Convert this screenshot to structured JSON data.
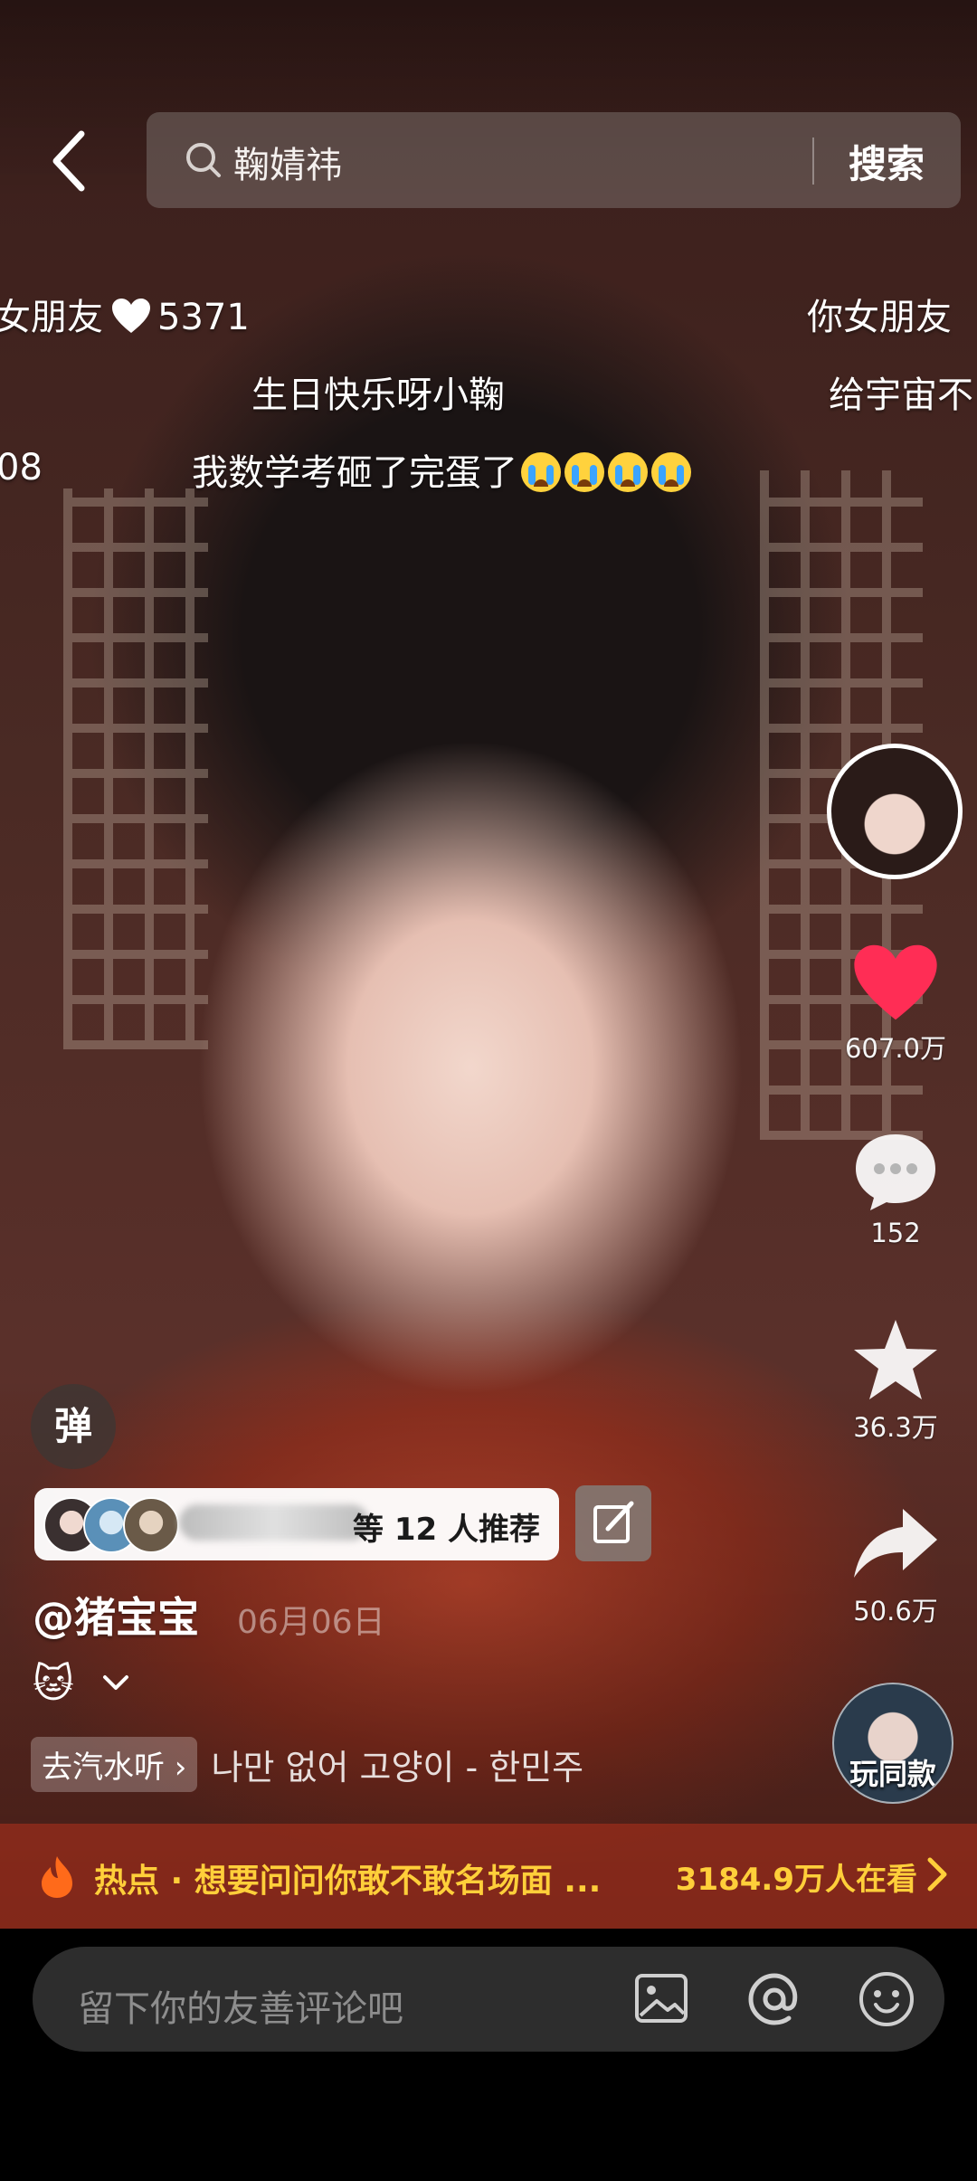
{
  "search": {
    "query": "鞠婧祎",
    "button_label": "搜索"
  },
  "danmaku": {
    "line1_left": "女朋友",
    "line1_count": "5371",
    "line1_right": "你女朋友",
    "line2_center": "生日快乐呀小鞠",
    "line2_right": "给宇宙不",
    "line3_left": "08",
    "line3_center": "我数学考砸了完蛋了"
  },
  "side_actions": {
    "likes": "607.0万",
    "comments": "152",
    "favorites": "36.3万",
    "shares": "50.6万",
    "play_same_label": "玩同款"
  },
  "post": {
    "danmu_toggle": "弹",
    "recommend_text": "等 12 人推荐",
    "author": "@猪宝宝",
    "date": "06月06日",
    "emoji": "🐱",
    "music_tag": "去汽水听",
    "song": "나만 없어 고양이 - 한민주"
  },
  "hot": {
    "text": "热点 · 想要问问你敢不敢名场面 ...",
    "watching": "3184.9万人在看"
  },
  "comment_input": {
    "placeholder": "留下你的友善评论吧"
  },
  "colors": {
    "like_red": "#ff2d55",
    "hot_yellow": "#ffcf3a",
    "bar_bg": "#2d2d2d"
  }
}
